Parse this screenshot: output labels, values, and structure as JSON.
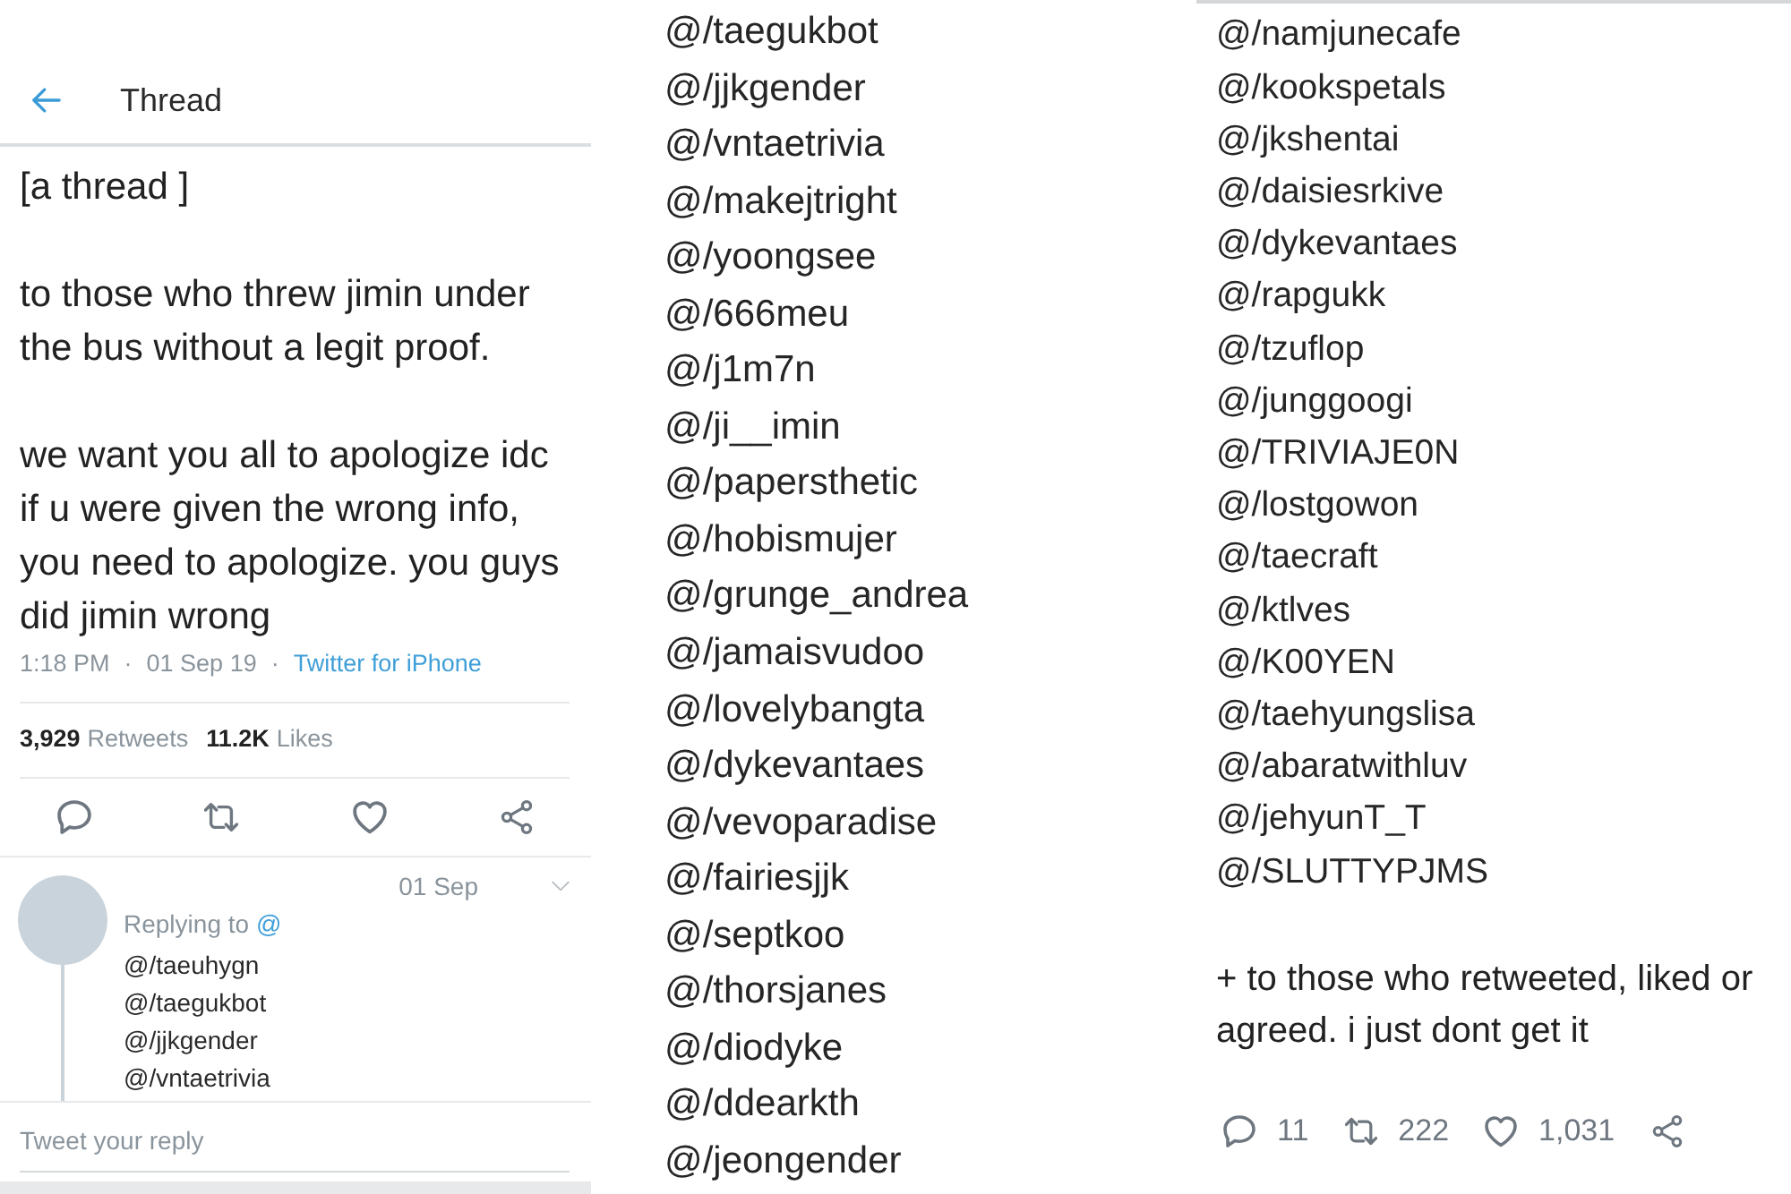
{
  "thread_panel": {
    "header": {
      "title": "Thread"
    },
    "tweet": {
      "paragraphs": [
        "[a thread ]",
        "to those who threw jimin under the bus without a legit proof.",
        "we want you all to apologize idc if u were given the wrong info, you need to apologize. you guys did jimin wrong"
      ],
      "meta": [
        {
          "kind": "text",
          "text": "1:18 PM"
        },
        {
          "kind": "separator",
          "text": "·"
        },
        {
          "kind": "text",
          "text": "01 Sep 19"
        },
        {
          "kind": "separator",
          "text": "·"
        },
        {
          "kind": "link",
          "text": "Twitter for iPhone"
        }
      ],
      "stats": [
        {
          "count": "3,929",
          "label": "Retweets"
        },
        {
          "count": "11.2K",
          "label": "Likes"
        }
      ]
    },
    "reply": {
      "date": "01 Sep",
      "replying_to": {
        "label": "Replying to",
        "mention": "@"
      },
      "handles": [
        "@/taeuhygn",
        "@/taegukbot",
        "@/jjkgender",
        "@/vntaetrivia"
      ]
    },
    "composer": {
      "placeholder": "Tweet your reply"
    }
  },
  "handles_panel": {
    "handles": [
      "@/taegukbot",
      "@/jjkgender",
      "@/vntaetrivia",
      "@/makejtright",
      "@/yoongsee",
      "@/666meu",
      "@/j1m7n",
      "@/ji__imin",
      "@/papersthetic",
      "@/hobismujer",
      "@/grunge_andrea",
      "@/jamaisvudoo",
      "@/lovelybangta",
      "@/dykevantaes",
      "@/vevoparadise",
      "@/fairiesjjk",
      "@/septkoo",
      "@/thorsjanes",
      "@/diodyke",
      "@/ddearkth",
      "@/jeongender"
    ]
  },
  "closing_panel": {
    "handles": [
      "@/namjunecafe",
      "@/kookspetals",
      "@/jkshentai",
      "@/daisiesrkive",
      "@/dykevantaes",
      "@/rapgukk",
      "@/tzuflop",
      "@/junggoogi",
      "@/TRIVIAJE0N",
      "@/lostgowon",
      "@/taecraft",
      "@/ktlves",
      "@/K00YEN",
      "@/taehyungslisa",
      "@/abaratwithluv",
      "@/jehyunT_T",
      "@/SLUTTYPJMS"
    ],
    "text": "+ to those who retweeted, liked or agreed. i just dont get it",
    "actions": [
      {
        "kind": "reply",
        "count": "11"
      },
      {
        "kind": "retweet",
        "count": "222"
      },
      {
        "kind": "like",
        "count": "1,031"
      },
      {
        "kind": "share"
      }
    ]
  }
}
